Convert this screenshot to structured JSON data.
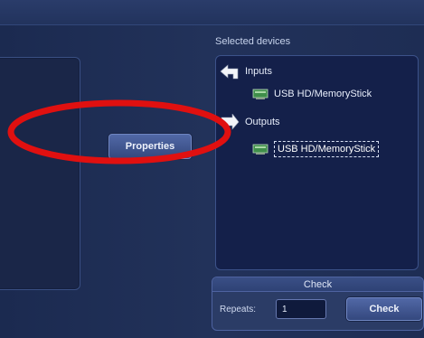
{
  "devices": {
    "caption": "Selected devices",
    "groups": [
      {
        "label": "Inputs",
        "icon": "arrow-left-icon",
        "devices": [
          {
            "label": "USB HD/MemoryStick",
            "selected": false,
            "icon": "usb-drive-icon"
          }
        ]
      },
      {
        "label": "Outputs",
        "icon": "arrow-right-icon",
        "devices": [
          {
            "label": "USB HD/MemoryStick",
            "selected": true,
            "icon": "usb-drive-icon"
          }
        ]
      }
    ]
  },
  "actions": {
    "properties_label": "Properties"
  },
  "check": {
    "title": "Check",
    "repeats_label": "Repeats:",
    "repeats_value": "1",
    "button_label": "Check"
  },
  "colors": {
    "background": "#1c2a4e",
    "panel": "#14204a",
    "button": "#4a60a0",
    "annotation": "#e01010"
  }
}
